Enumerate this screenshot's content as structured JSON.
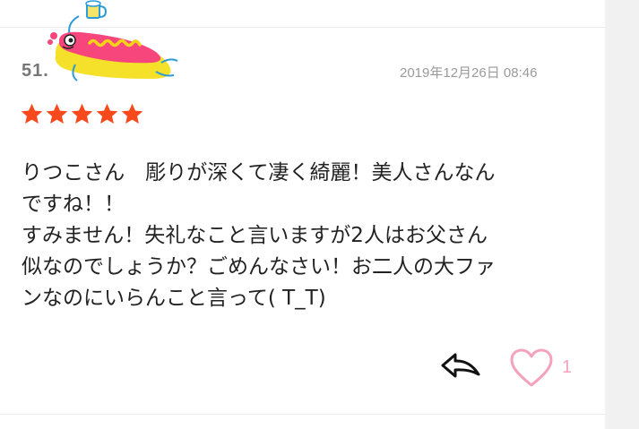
{
  "review": {
    "username": "51.",
    "timestamp": "2019年12月26日 08:46",
    "rating": 5,
    "rating_max": 5,
    "comment_lines": [
      "りつこさん　彫りが深くて凄く綺麗！美人さんなん",
      "ですね！！",
      "すみません！失礼なこと言いますが2人はお父さん",
      "似なのでしょうか？ごめんなさい！お二人の大ファ",
      "ンなのにいらんこと言って( T_T)"
    ],
    "like_count": "1"
  },
  "icons": {
    "mascot": "hotdog-mascot-icon",
    "star": "star-icon",
    "reply": "reply-arrow-icon",
    "like": "heart-icon"
  },
  "colors": {
    "star": "#f7491c",
    "heart": "#f4a3bb",
    "text": "#222222",
    "meta": "#9a9a9a"
  }
}
